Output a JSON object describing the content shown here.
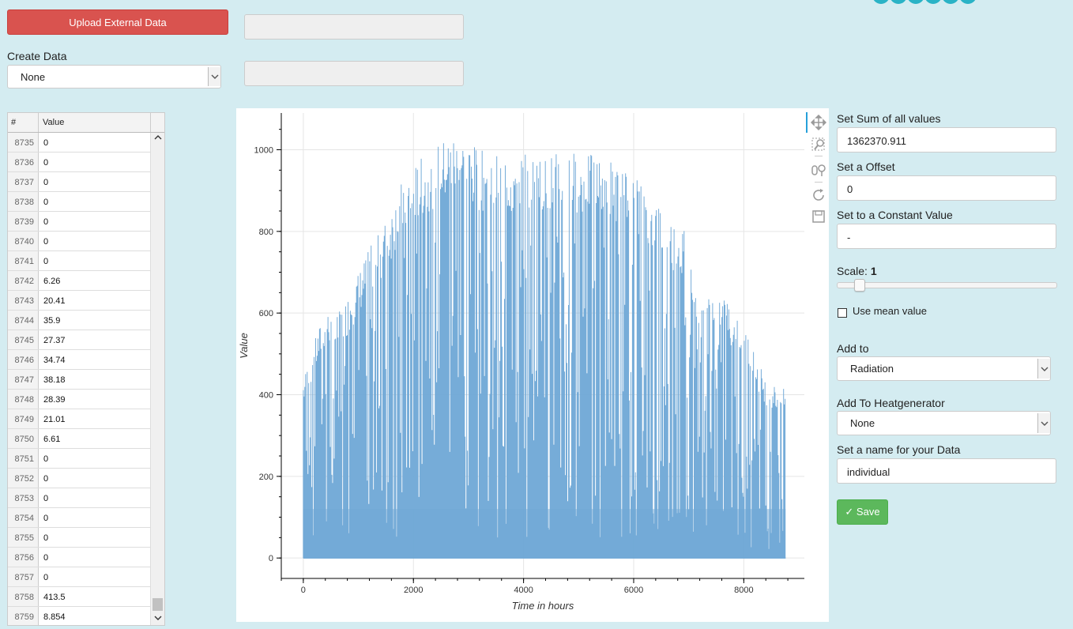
{
  "top": {
    "upload_button": "Upload External Data",
    "create_data_label": "Create Data",
    "create_data_value": "None"
  },
  "table": {
    "col_index": "#",
    "col_value": "Value",
    "rows": [
      {
        "i": "8735",
        "v": "0"
      },
      {
        "i": "8736",
        "v": "0"
      },
      {
        "i": "8737",
        "v": "0"
      },
      {
        "i": "8738",
        "v": "0"
      },
      {
        "i": "8739",
        "v": "0"
      },
      {
        "i": "8740",
        "v": "0"
      },
      {
        "i": "8741",
        "v": "0"
      },
      {
        "i": "8742",
        "v": "6.26"
      },
      {
        "i": "8743",
        "v": "20.41"
      },
      {
        "i": "8744",
        "v": "35.9"
      },
      {
        "i": "8745",
        "v": "27.37"
      },
      {
        "i": "8746",
        "v": "34.74"
      },
      {
        "i": "8747",
        "v": "38.18"
      },
      {
        "i": "8748",
        "v": "28.39"
      },
      {
        "i": "8749",
        "v": "21.01"
      },
      {
        "i": "8750",
        "v": "6.61"
      },
      {
        "i": "8751",
        "v": "0"
      },
      {
        "i": "8752",
        "v": "0"
      },
      {
        "i": "8753",
        "v": "0"
      },
      {
        "i": "8754",
        "v": "0"
      },
      {
        "i": "8755",
        "v": "0"
      },
      {
        "i": "8756",
        "v": "0"
      },
      {
        "i": "8757",
        "v": "0"
      },
      {
        "i": "8758",
        "v": "413.5"
      },
      {
        "i": "8759",
        "v": "8.854"
      }
    ]
  },
  "chart_data": {
    "type": "area",
    "xlabel": "Time in hours",
    "ylabel": "Value",
    "xlim": [
      -400,
      9100
    ],
    "ylim": [
      -50,
      1090
    ],
    "xticks": [
      0,
      2000,
      4000,
      6000,
      8000
    ],
    "yticks": [
      0,
      200,
      400,
      600,
      800,
      1000
    ],
    "grid": true,
    "color": "#6fa8d6",
    "series": [
      {
        "x": [
          0,
          200,
          400,
          600,
          800,
          1000,
          1200,
          1400,
          1600,
          1800,
          2000,
          2200,
          2400,
          2600,
          2800,
          3000,
          3200,
          3400,
          3600,
          3800,
          4000,
          4200,
          4400,
          4600,
          4800,
          5000,
          5200,
          5400,
          5600,
          5800,
          6000,
          6200,
          6400,
          6600,
          6800,
          7000,
          7200,
          7400,
          7600,
          7800,
          8000,
          8200,
          8400,
          8600,
          8760
        ],
        "y_max": [
          440,
          530,
          610,
          590,
          640,
          700,
          760,
          800,
          860,
          930,
          960,
          990,
          1010,
          1030,
          1040,
          1020,
          1000,
          990,
          1000,
          980,
          1010,
          990,
          980,
          1000,
          1010,
          990,
          990,
          980,
          980,
          950,
          940,
          920,
          880,
          840,
          820,
          800,
          620,
          660,
          660,
          600,
          580,
          500,
          440,
          420,
          413.5
        ]
      }
    ]
  },
  "tools": [
    "pan-icon",
    "box-zoom-icon",
    "wheel-zoom-icon",
    "reset-icon",
    "save-icon"
  ],
  "panel": {
    "sum_label": "Set Sum of all values",
    "sum_value": "1362370.911",
    "offset_label": "Set a Offset",
    "offset_value": "0",
    "constant_label": "Set to a Constant Value",
    "constant_value": "-",
    "scale_label": "Scale: ",
    "scale_value": "1",
    "scale_level": 1,
    "mean_label": "Use mean value",
    "mean_checked": false,
    "add_to_label": "Add to",
    "add_to_value": "Radiation",
    "heatgen_label": "Add To Heatgenerator",
    "heatgen_value": "None",
    "name_label": "Set a name for your Data",
    "name_value": "individual",
    "save_label": "✓ Save"
  }
}
